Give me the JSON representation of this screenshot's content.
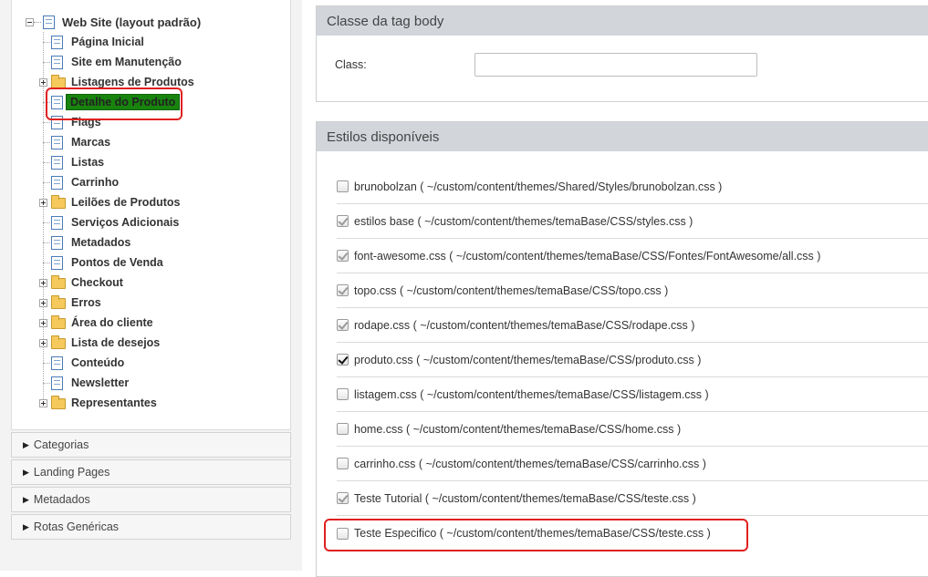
{
  "tree": {
    "root_label": "Web Site (layout padrão)",
    "items": [
      {
        "label": "Página Inicial",
        "icon": "page-icon",
        "expandable": false
      },
      {
        "label": "Site em Manutenção",
        "icon": "page-icon",
        "expandable": false
      },
      {
        "label": "Listagens de Produtos",
        "icon": "folder-icon",
        "expandable": true
      },
      {
        "label": "Detalhe do Produto",
        "icon": "page-icon",
        "expandable": false,
        "selected": true
      },
      {
        "label": "Flags",
        "icon": "page-icon",
        "expandable": false
      },
      {
        "label": "Marcas",
        "icon": "page-icon",
        "expandable": false
      },
      {
        "label": "Listas",
        "icon": "page-icon",
        "expandable": false
      },
      {
        "label": "Carrinho",
        "icon": "page-icon",
        "expandable": false
      },
      {
        "label": "Leilões de Produtos",
        "icon": "folder-icon",
        "expandable": true
      },
      {
        "label": "Serviços Adicionais",
        "icon": "page-icon",
        "expandable": false
      },
      {
        "label": "Metadados",
        "icon": "page-icon",
        "expandable": false
      },
      {
        "label": "Pontos de Venda",
        "icon": "page-icon",
        "expandable": false
      },
      {
        "label": "Checkout",
        "icon": "folder-icon",
        "expandable": true
      },
      {
        "label": "Erros",
        "icon": "folder-icon",
        "expandable": true
      },
      {
        "label": "Área do cliente",
        "icon": "folder-icon",
        "expandable": true
      },
      {
        "label": "Lista de desejos",
        "icon": "folder-icon",
        "expandable": true
      },
      {
        "label": "Conteúdo",
        "icon": "page-icon",
        "expandable": false
      },
      {
        "label": "Newsletter",
        "icon": "page-icon",
        "expandable": false
      },
      {
        "label": "Representantes",
        "icon": "folder-icon",
        "expandable": true
      }
    ]
  },
  "accordions": [
    {
      "label": "Categorias"
    },
    {
      "label": "Landing Pages"
    },
    {
      "label": "Metadados"
    },
    {
      "label": "Rotas Genéricas"
    }
  ],
  "body_class_panel": {
    "title": "Classe da tag body",
    "class_label": "Class:",
    "class_value": ""
  },
  "styles_panel": {
    "title": "Estilos disponíveis",
    "items": [
      {
        "label": "brunobolzan ( ~/custom/content/themes/Shared/Styles/brunobolzan.css )",
        "state": "unchecked"
      },
      {
        "label": "estilos base ( ~/custom/content/themes/temaBase/CSS/styles.css )",
        "state": "checked-disabled"
      },
      {
        "label": "font-awesome.css ( ~/custom/content/themes/temaBase/CSS/Fontes/FontAwesome/all.css )",
        "state": "checked-disabled"
      },
      {
        "label": "topo.css ( ~/custom/content/themes/temaBase/CSS/topo.css )",
        "state": "checked-disabled"
      },
      {
        "label": "rodape.css ( ~/custom/content/themes/temaBase/CSS/rodape.css )",
        "state": "checked-disabled"
      },
      {
        "label": "produto.css ( ~/custom/content/themes/temaBase/CSS/produto.css )",
        "state": "checked"
      },
      {
        "label": "listagem.css ( ~/custom/content/themes/temaBase/CSS/listagem.css )",
        "state": "unchecked"
      },
      {
        "label": "home.css ( ~/custom/content/themes/temaBase/CSS/home.css )",
        "state": "unchecked"
      },
      {
        "label": "carrinho.css ( ~/custom/content/themes/temaBase/CSS/carrinho.css )",
        "state": "unchecked"
      },
      {
        "label": "Teste Tutorial ( ~/custom/content/themes/temaBase/CSS/teste.css )",
        "state": "checked-disabled"
      },
      {
        "label": "Teste Especifico ( ~/custom/content/themes/temaBase/CSS/teste.css )",
        "state": "unchecked"
      }
    ]
  },
  "colors": {
    "selected_node_bg": "#18840e",
    "panel_header_bg": "#d2d6db",
    "annotation_red": "#e02020"
  }
}
